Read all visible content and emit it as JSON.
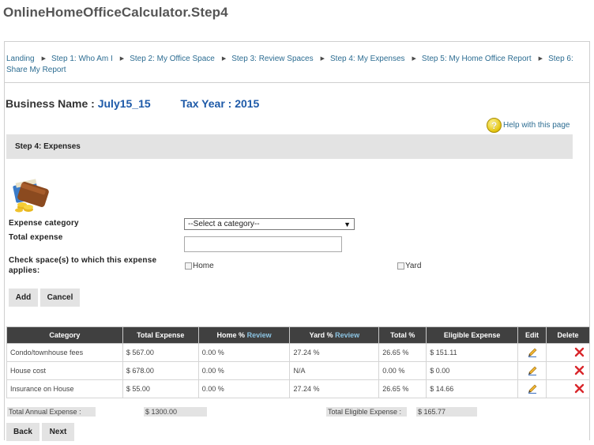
{
  "page": {
    "title": "OnlineHomeOfficeCalculator.Step4"
  },
  "breadcrumb": [
    {
      "label": "Landing"
    },
    {
      "label": "Step 1: Who Am I"
    },
    {
      "label": "Step 2: My Office Space"
    },
    {
      "label": "Step 3: Review Spaces"
    },
    {
      "label": "Step 4: My Expenses"
    },
    {
      "label": "Step 5: My Home Office Report"
    },
    {
      "label": "Step 6: Share My Report"
    }
  ],
  "business": {
    "name_label": "Business Name :",
    "name_value": "July15_15",
    "year_label": "Tax Year :",
    "year_value": "2015"
  },
  "help": {
    "label": "Help with this page",
    "icon": "question-icon"
  },
  "section": {
    "title": "Step 4: Expenses"
  },
  "form": {
    "category_label": "Expense category",
    "category_value": "--Select a category--",
    "total_label": "Total expense",
    "total_value": "",
    "spaces_label": "Check space(s) to which this expense applies:",
    "spaces": [
      {
        "label": "Home",
        "checked": false
      },
      {
        "label": "Yard",
        "checked": false
      }
    ],
    "add_label": "Add",
    "cancel_label": "Cancel"
  },
  "table": {
    "headers": {
      "category": "Category",
      "total": "Total Expense",
      "home": "Home %",
      "home_link": "Review",
      "yard": "Yard %",
      "yard_link": "Review",
      "total_pct": "Total %",
      "eligible": "Eligible Expense",
      "edit": "Edit",
      "delete": "Delete"
    },
    "rows": [
      {
        "category": "Condo/townhouse fees",
        "total": "$ 567.00",
        "home": "0.00 %",
        "yard": "27.24 %",
        "total_pct": "26.65 %",
        "eligible": "$ 151.11"
      },
      {
        "category": "House cost",
        "total": "$ 678.00",
        "home": "0.00 %",
        "yard": "N/A",
        "total_pct": "0.00 %",
        "eligible": "$ 0.00"
      },
      {
        "category": "Insurance on House",
        "total": "$ 55.00",
        "home": "0.00 %",
        "yard": "27.24 %",
        "total_pct": "26.65 %",
        "eligible": "$ 14.66"
      }
    ]
  },
  "totals": {
    "annual_label": "Total Annual Expense :",
    "annual_value": "$ 1300.00",
    "eligible_label": "Total Eligible Expense :",
    "eligible_value": "$ 165.77"
  },
  "nav": {
    "back_label": "Back",
    "next_label": "Next"
  },
  "colors": {
    "accent": "#2d6d92",
    "business": "#1e5aa8",
    "header_bg": "#404040",
    "delete": "#d9262b"
  }
}
